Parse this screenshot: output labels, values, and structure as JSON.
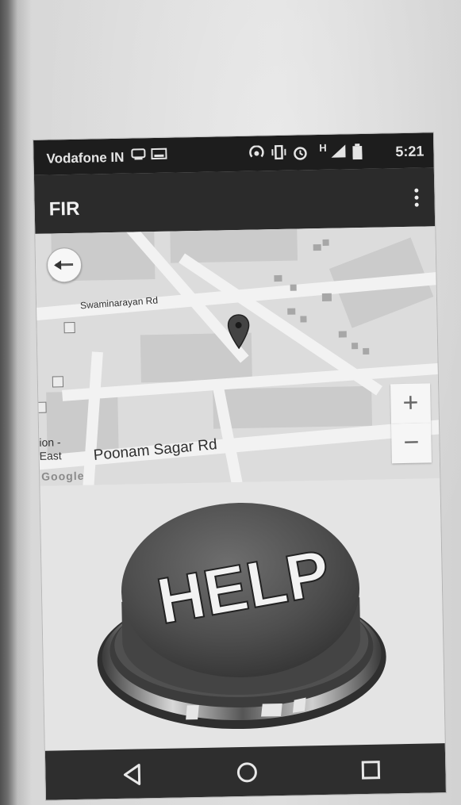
{
  "status_bar": {
    "carrier": "Vodafone IN",
    "network": "H",
    "time": "5:21"
  },
  "app_bar": {
    "title": "FIR"
  },
  "map": {
    "road_labels": [
      "Swaminarayan Rd",
      "Poonam Sagar Rd"
    ],
    "edge_labels": [
      "ion -",
      "East"
    ],
    "attribution": "Google",
    "zoom_in_label": "+",
    "zoom_out_label": "−"
  },
  "help_button": {
    "label": "HELP"
  },
  "colors": {
    "status_bar": "#1d1d1d",
    "app_bar": "#2b2b2b",
    "nav_bar": "#2e2e2e",
    "button_top": "#585858"
  },
  "icons": [
    "cast-icon",
    "image-icon",
    "hotspot-icon",
    "vibrate-icon",
    "alarm-icon",
    "signal-icon",
    "battery-icon",
    "overflow-menu-icon",
    "compass-icon",
    "location-pin-icon",
    "back-icon",
    "home-icon",
    "recents-icon"
  ]
}
